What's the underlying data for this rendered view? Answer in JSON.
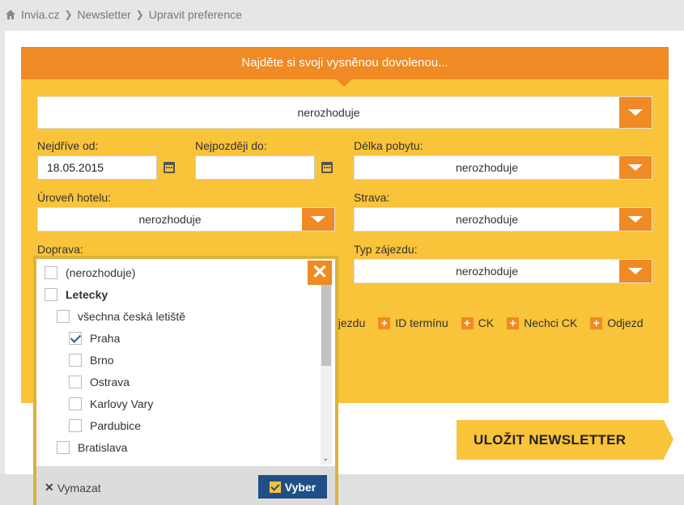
{
  "breadcrumb": {
    "items": [
      "Invia.cz",
      "Newsletter",
      "Upravit preference"
    ]
  },
  "form": {
    "header": "Najděte si svoji vysněnou dovolenou...",
    "destination_select": "nerozhoduje",
    "date_from_label": "Nejdříve od:",
    "date_from_value": "18.05.2015",
    "date_to_label": "Nejpozději do:",
    "date_to_value": "",
    "stay_length_label": "Délka pobytu:",
    "stay_length_value": "nerozhoduje",
    "hotel_level_label": "Úroveň hotelu:",
    "hotel_level_value": "nerozhoduje",
    "board_label": "Strava:",
    "board_value": "nerozhoduje",
    "transport_label": "Doprava:",
    "trip_type_label": "Typ zájezdu:",
    "trip_type_value": "nerozhoduje"
  },
  "filters": [
    {
      "label": "ájezdu",
      "plus": false
    },
    {
      "label": "ID termínu",
      "plus": true
    },
    {
      "label": "CK",
      "plus": true
    },
    {
      "label": "Nechci CK",
      "plus": true
    },
    {
      "label": "Odjezd",
      "plus": true
    }
  ],
  "save_button": "ULOŽIT NEWSLETTER",
  "transport_dropdown": {
    "items": [
      {
        "label": "(nerozhoduje)",
        "checked": false,
        "level": 0,
        "bold": false
      },
      {
        "label": "Letecky",
        "checked": false,
        "level": 0,
        "bold": true
      },
      {
        "label": "všechna česká letiště",
        "checked": false,
        "level": 1,
        "bold": false
      },
      {
        "label": "Praha",
        "checked": true,
        "level": 2,
        "bold": false
      },
      {
        "label": "Brno",
        "checked": false,
        "level": 2,
        "bold": false
      },
      {
        "label": "Ostrava",
        "checked": false,
        "level": 2,
        "bold": false
      },
      {
        "label": "Karlovy Vary",
        "checked": false,
        "level": 2,
        "bold": false
      },
      {
        "label": "Pardubice",
        "checked": false,
        "level": 2,
        "bold": false
      },
      {
        "label": "Bratislava",
        "checked": false,
        "level": 1,
        "bold": false
      }
    ],
    "clear_label": "Vymazat",
    "choose_label": "Vyber",
    "close_glyph": "✕"
  },
  "colors": {
    "orange": "#f08a24",
    "yellow": "#f9c33a",
    "navy": "#1f4f86"
  }
}
